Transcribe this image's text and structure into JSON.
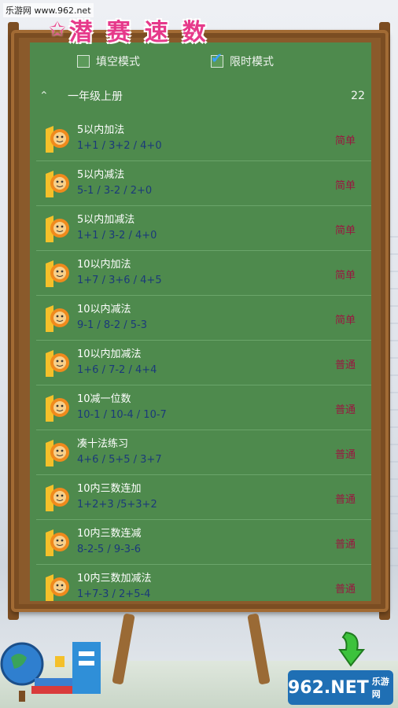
{
  "watermark": "乐游网 www.962.net",
  "app_title": "潜赛速数",
  "modes": [
    {
      "label": "填空模式",
      "checked": false
    },
    {
      "label": "限时模式",
      "checked": true
    }
  ],
  "group": {
    "title": "一年级上册",
    "count": "22"
  },
  "rows": [
    {
      "title": "5以内加法",
      "sub": "1+1 / 3+2 / 4+0",
      "level": "简单"
    },
    {
      "title": "5以内减法",
      "sub": "5-1 / 3-2 / 2+0",
      "level": "简单"
    },
    {
      "title": "5以内加减法",
      "sub": "1+1 / 3-2 / 4+0",
      "level": "简单"
    },
    {
      "title": "10以内加法",
      "sub": "1+7 / 3+6 / 4+5",
      "level": "简单"
    },
    {
      "title": "10以内减法",
      "sub": "9-1 / 8-2 / 5-3",
      "level": "简单"
    },
    {
      "title": "10以内加减法",
      "sub": "1+6 / 7-2 / 4+4",
      "level": "普通"
    },
    {
      "title": "10减一位数",
      "sub": "10-1 / 10-4 / 10-7",
      "level": "普通"
    },
    {
      "title": "凑十法练习",
      "sub": "4+6 / 5+5 / 3+7",
      "level": "普通"
    },
    {
      "title": "10内三数连加",
      "sub": "1+2+3 /5+3+2",
      "level": "普通"
    },
    {
      "title": "10内三数连减",
      "sub": "8-2-5 / 9-3-6",
      "level": "普通"
    },
    {
      "title": "10内三数加减法",
      "sub": "1+7-3 / 2+5-4",
      "level": "普通"
    }
  ],
  "logo": {
    "text": "962.NET",
    "sub": "乐游网"
  },
  "colors": {
    "board": "#4e8a4d",
    "title": "#e6398a",
    "level": "#9a1740",
    "sub": "#1b3a7a"
  }
}
